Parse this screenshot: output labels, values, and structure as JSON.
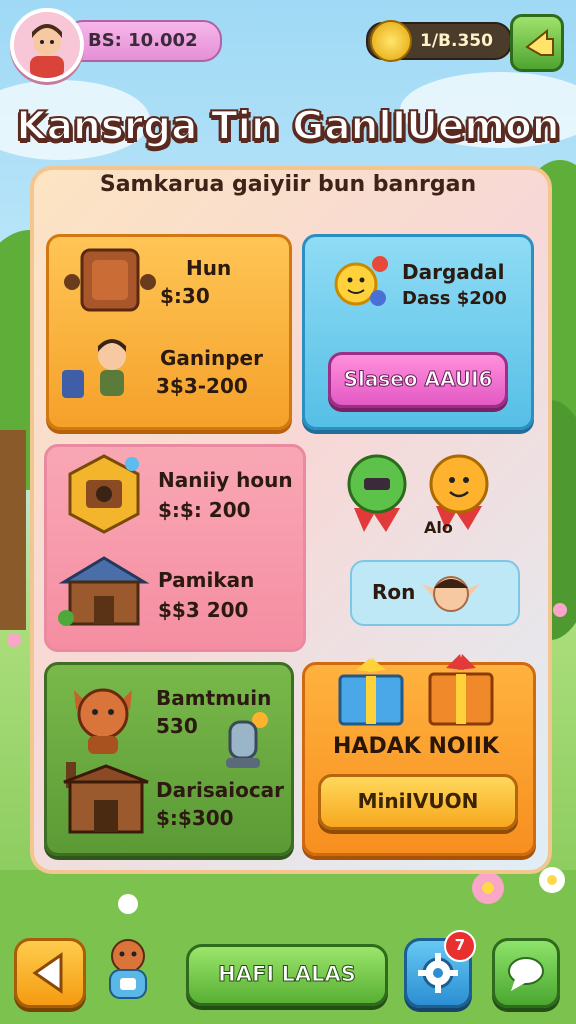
{
  "header": {
    "balance_label": "BS: 10.002",
    "coins_label": "1/B.350"
  },
  "title": "Kansrga Tin GanlIUemon",
  "subtitle": "Samkarua gaiyiir bun banrgan",
  "cards": {
    "top_left": {
      "item1_name": "Hun",
      "item1_price": "$:30",
      "item2_name": "Ganinper",
      "item2_price": "3$3-200"
    },
    "top_right": {
      "name": "Dargadal",
      "price": "Dass $200",
      "button_label": "Slaseo AAUI6"
    },
    "middle_left": {
      "item1_name": "Naniiy houn",
      "item1_price": "$:$: 200",
      "item2_name": "Pamikan",
      "item2_price": "$$3 200"
    },
    "middle_right": {
      "character_label": "Alo",
      "ron_label": "Ron"
    },
    "bottom_left": {
      "item1_name": "Bamtmuin",
      "item1_price": "530",
      "item2_name": "Darisaiocar",
      "item2_price": "$:$300"
    },
    "bottom_right": {
      "label": "HADAK NOIIK",
      "button_label": "MiniIVUON"
    }
  },
  "bottom_bar": {
    "home_label": "HAFI LALAS",
    "notification_count": "7"
  },
  "colors": {
    "accent_pink": "#e35ac4",
    "accent_green": "#58b034",
    "accent_orange": "#f7a81f",
    "accent_blue": "#2c8fd3"
  }
}
